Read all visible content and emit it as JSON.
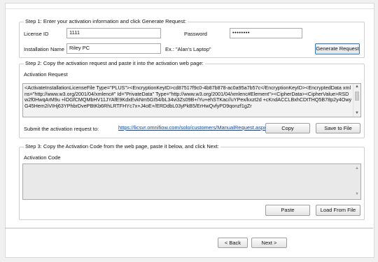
{
  "step1": {
    "legend": "Step 1: Enter your activation information and click Generate Request:",
    "license_id_label": "License ID",
    "license_id_value": "1111",
    "password_label": "Password",
    "password_value": "••••••••",
    "installation_name_label": "Installation Name",
    "installation_name_value": "Riley PC",
    "example_text": "Ex.: \"Alan's Laptop\"",
    "generate_button": "Generate Request"
  },
  "step2": {
    "legend": "Step 2: Copy the activation request and paste it into the activation web page:",
    "request_label": "Activation Request",
    "request_text": "<ActivateInstallationLicenseFile Type=\"PLUS\"><EncryptionKeyID>cd87517f9c0-4b87b878-ac0a95a7b57c</EncryptionKeyID><EncryptedData xmlns=\"http://www.w3.org/2001/04/xmlenc#\" Id=\"PrivateData\" Type=\"http://www.w3.org/2001/04/xmlenc#Element\"><CipherData><CipherValue>RSDw2f0HwqArM9u +lOGfCMQMbHV11JYAfE9KdxEvkNm5GI54/bL34vi3Zs09B+/Yu+ehSTKac//uYPex/kxzt2d +cKndACCLBxhCDtTHQ5B78p2y4OwyG45Hem2iVIHj63YPhbrDvePBtKb6RhLRTFHYc7x+J4oE+/ERDdbL03yPkB5/ErHwQvfyPD9qonzf1gZr",
    "submit_label": "Submit the activation request to:",
    "submit_url": "https://licsvr.omnifiow.com/solo/customers/ManualRequest.aspx",
    "copy_button": "Copy",
    "save_button": "Save to File"
  },
  "step3": {
    "legend": "Step 3: Copy the Activation Code from the web page, paste it below, and click Next:",
    "code_label": "Activation Code",
    "code_value": "",
    "paste_button": "Paste",
    "load_button": "Load From File"
  },
  "nav": {
    "back_button": "< Back",
    "next_button": "Next >"
  }
}
